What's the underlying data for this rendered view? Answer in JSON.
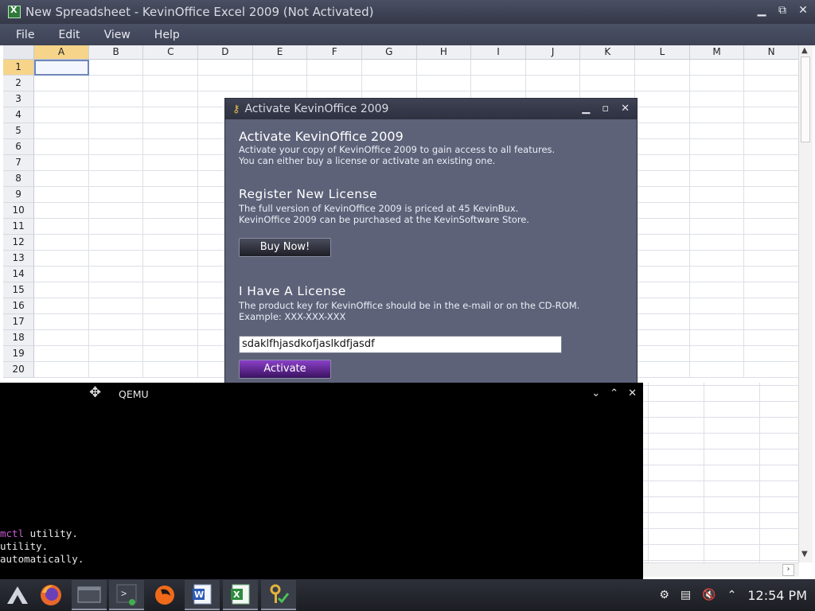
{
  "excel": {
    "title": "New Spreadsheet - KevinOffice Excel 2009 (Not Activated)",
    "menu": [
      "File",
      "Edit",
      "View",
      "Help"
    ],
    "columns": [
      "A",
      "B",
      "C",
      "D",
      "E",
      "F",
      "G",
      "H",
      "I",
      "J",
      "K",
      "L",
      "M",
      "N"
    ],
    "rows": [
      "1",
      "2",
      "3",
      "4",
      "5",
      "6",
      "7",
      "8",
      "9",
      "10",
      "11",
      "12",
      "13",
      "14",
      "15",
      "16",
      "17",
      "18",
      "19",
      "20"
    ],
    "selected_cell": "A1",
    "window_controls": {
      "minimize": "▁",
      "restore": "⧉",
      "close": "✕"
    }
  },
  "dialog": {
    "title": "Activate KevinOffice 2009",
    "heading": "Activate KevinOffice 2009",
    "intro_line1": "Activate your copy of KevinOffice 2009 to gain access to all features.",
    "intro_line2": "You can either buy a license or activate an existing one.",
    "register_heading": "Register New License",
    "register_line1": "The full version of KevinOffice 2009 is priced at 45 KevinBux.",
    "register_line2": "KevinOffice 2009 can be purchased at the KevinSoftware Store.",
    "buy_label": "Buy Now!",
    "license_heading": "I Have A License",
    "license_line1": "The product key for KevinOffice should be in the e-mail or on the CD-ROM.",
    "license_line2": "Example: XXX-XXX-XXX",
    "key_value": "sdaklfhjasdkofjaslkdfjasdf",
    "activate_label": "Activate"
  },
  "qemu": {
    "title": "QEMU",
    "terminal_lines": [
      {
        "prefix": "mctl",
        "rest": " utility."
      },
      {
        "prefix": "",
        "rest": "utility."
      },
      {
        "prefix": "",
        "rest": "automatically."
      }
    ]
  },
  "taskbar": {
    "items": [
      "app-launcher-icon",
      "firefox-icon",
      "file-manager-icon",
      "terminal-icon",
      "qemu-icon",
      "word-icon",
      "excel-icon",
      "activation-key-icon"
    ],
    "clock": "12:54 PM"
  }
}
